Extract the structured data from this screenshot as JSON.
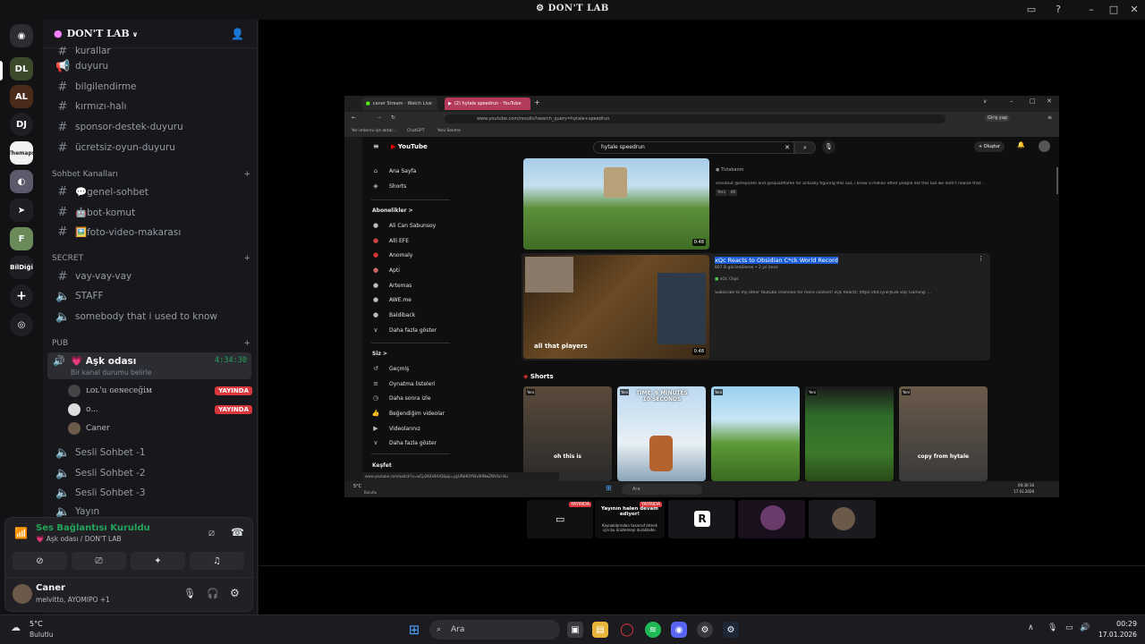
{
  "window": {
    "title": "DON'T LAB"
  },
  "servers": [
    "DJ",
    "Themaps",
    "BilDiği"
  ],
  "server": {
    "name": "DON'T LAB"
  },
  "channels": {
    "top": [
      "kurallar",
      "duyuru",
      "bilgilendirme",
      "kırmızı-halı",
      "sponsor-destek-duyuru",
      "ücretsiz-oyun-duyuru"
    ],
    "cat_sohbet": "Sohbet Kanalları",
    "sohbet": [
      "💬genel-sohbet",
      "🤖bot-komut",
      "🖼️foto-video-makarası"
    ],
    "cat_secret": "SECRET",
    "secret": [
      "vay-vay-vay",
      "STAFF",
      "somebody that i used to know"
    ],
    "cat_pub": "PUB",
    "active": {
      "name": "💗 Aşk odası",
      "timer": "4:34:30",
      "status": "Bir kanal durumu belirle"
    },
    "users": [
      {
        "name": "ʟoʟ'u ɢeɴeceğiм",
        "live": "YAYINDA"
      },
      {
        "name": "o...",
        "live": "YAYINDA"
      },
      {
        "name": "Caner",
        "live": ""
      }
    ],
    "voice": [
      "Sesli Sohbet -1",
      "Sesli Sohbet -2",
      "Sesli Sohbet -3",
      "Yayın"
    ]
  },
  "voice_panel": {
    "status": "Ses Bağlantısı Kuruldu",
    "location": "💗 Aşk odası / DON'T LAB"
  },
  "user": {
    "name": "Caner",
    "activity": "melvitto, AYOMIPO +1"
  },
  "browser": {
    "tabs": [
      "caner Stream - Watch Live",
      "(2) hytale speedrun - YouTube"
    ],
    "url": "www.youtube.com/results?search_query=hytale+speedrun",
    "bookmarks": [
      "Yer imlerini içe aktar...",
      "ChatGPT",
      "Yeni Sekme"
    ],
    "search": "hytale speedrun",
    "yt_logo": "YouTube",
    "create": "+ Oluştur",
    "sign_in": "Giriş yap",
    "sidebar_main": [
      "Ana Sayfa",
      "Shorts"
    ],
    "subs_head": "Abonelikler >",
    "subs": [
      "Ali Can Sabunsoy",
      "Alli EFE",
      "Anomaly",
      "Apti",
      "Artemas",
      "AWE.me",
      "Baldiback",
      "Daha fazla göster"
    ],
    "you_head": "Siz >",
    "you": [
      "Geçmiş",
      "Oynatma listeleri",
      "Daha sonra izle",
      "Beğendiğim videolar",
      "Videolarınız",
      "Daha fazla göster"
    ],
    "explore": "Keşfet",
    "video1": {
      "channel": "Tiziabaom",
      "desc": "shoutout @stepickle and @squadflame for actually figuring this out, i know a million other people did this but we didn't realize that ...",
      "duration": "0:48",
      "badges": [
        "Yeni",
        "4K"
      ]
    },
    "video2": {
      "title": "xQc Reacts to Obsidian C*ck World Record",
      "meta": "807 B görüntüleme • 2 yıl önce",
      "channel": "xQc Clips",
      "desc": "Subscribe to my other Youtube channels for more content! xQc Reacts: https://bit.ly/3FJk36 xQc Gaming: ...",
      "duration": "0:48",
      "caption": "all that players"
    },
    "shorts_head": "Shorts",
    "shorts": [
      {
        "badge": "Yeni",
        "caption": "oh this is"
      },
      {
        "badge": "Yeni",
        "caption": "TIME: 6 MINUTES 10 SECONDS"
      },
      {
        "badge": "Yeni",
        "caption": ""
      },
      {
        "badge": "Yeni",
        "caption": ""
      },
      {
        "badge": "Yeni",
        "caption": "copy from hytale"
      }
    ],
    "status_url": "www.youtube.com/watch?v=wCp2K4a9rUQ&pp=ygUPaHl0YWxlIHNwZWVkcnVu",
    "weather": {
      "temp": "5°C",
      "desc": "Bulutlu"
    },
    "search_placeholder": "Ara",
    "clock": {
      "time": "00:30:16",
      "date": "17.01.2026"
    }
  },
  "streams": {
    "paused_title": "Yayının halen devam ediyor!",
    "paused_sub": "Kaynaklarından tasarruf etmek için bu önizlemeyi durakladık.",
    "live": "YAYINDA"
  },
  "taskbar": {
    "weather": {
      "temp": "5°C",
      "desc": "Bulutlu"
    },
    "search_placeholder": "Ara",
    "time": "00:29",
    "date": "17.01.2026"
  }
}
